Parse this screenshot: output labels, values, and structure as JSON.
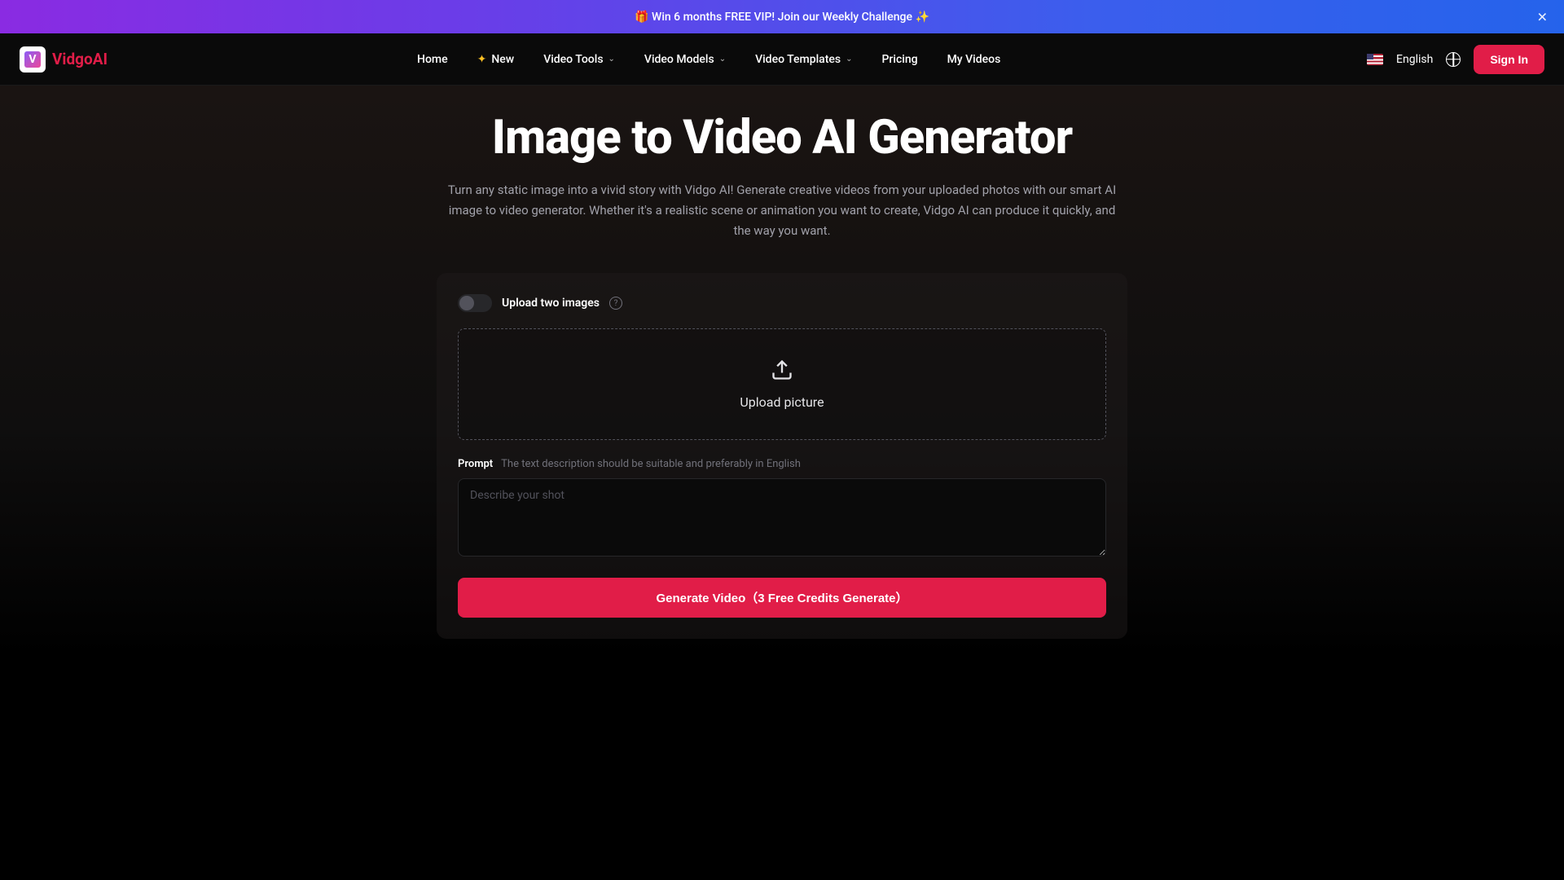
{
  "banner": {
    "text": "🎁 Win 6 months FREE VIP! Join our Weekly Challenge ✨"
  },
  "header": {
    "brand": "VidgoAI",
    "nav": {
      "home": "Home",
      "new": "New",
      "video_tools": "Video Tools",
      "video_models": "Video Models",
      "video_templates": "Video Templates",
      "pricing": "Pricing",
      "my_videos": "My Videos"
    },
    "language": "English",
    "signin": "Sign In"
  },
  "hero": {
    "title": "Image to Video AI Generator",
    "subtitle": "Turn any static image into a vivid story with Vidgo AI! Generate creative videos from your uploaded photos with our smart AI image to video generator. Whether it's a realistic scene or animation you want to create, Vidgo AI can produce it quickly, and the way you want."
  },
  "card": {
    "toggle_label": "Upload two images",
    "upload_text": "Upload picture",
    "prompt_label": "Prompt",
    "prompt_hint": "The text description should be suitable and preferably in English",
    "prompt_placeholder": "Describe your shot",
    "generate_button": "Generate Video（3 Free Credits Generate）"
  }
}
